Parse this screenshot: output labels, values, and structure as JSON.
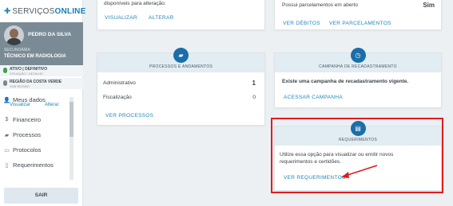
{
  "brand": {
    "prefix": "SERVIÇOS",
    "suffix": "ONLINE"
  },
  "profile": {
    "name": "PEDRO DA SILVA",
    "subtitle": "SECUNDÁRIA",
    "role": "TÉCNICO EM RADIOLOGIA"
  },
  "status": {
    "situacao": "ATIVO | DEFINITIVO",
    "situacao_detail": "SITUAÇÃO / DETALHE",
    "regiao": "REGIÃO DA COSTA VERDE",
    "regiao_detail": "SUB REGIÃO",
    "situacao_color": "#3fa14a",
    "regiao_color": "#7a8790"
  },
  "sidebar": {
    "meus_dados": "Meus dados",
    "visualizar": "Visualizar",
    "alterar": "Alterar",
    "items": [
      {
        "label": "Financeiro",
        "icon": "dollar-icon"
      },
      {
        "label": "Processos",
        "icon": "truck-icon"
      },
      {
        "label": "Protocolos",
        "icon": "folder-icon"
      },
      {
        "label": "Requerimentos",
        "icon": "document-icon"
      }
    ],
    "logout": "SAIR"
  },
  "top_left_card": {
    "text": "disponíveis para alteração.",
    "visualizar": "VISUALIZAR",
    "alterar": "ALTERAR"
  },
  "top_right_card": {
    "question": "Possui parcelamentos em aberto",
    "answer": "Sim",
    "ver_debitos": "VER DÉBITOS",
    "ver_parcelamentos": "VER PARCELAMENTOS"
  },
  "processos_card": {
    "title": "PROCESSOS E ANDAMENTOS",
    "rows": [
      {
        "label": "Administrativo",
        "value": "1"
      },
      {
        "label": "Fiscalização",
        "value": "0"
      }
    ],
    "link": "VER PROCESSOS"
  },
  "recadastramento_card": {
    "title": "CAMPANHA DE RECADASTRAMENTO",
    "text": "Existe uma campanha de recadastramento vigente.",
    "link": "ACESSAR CAMPANHA"
  },
  "requerimentos_card": {
    "title": "REQUERIMENTOS",
    "text_line1": "Utilize essa opção para visualizar ou emitir novos",
    "text_line2": "requerimentos e certidões.",
    "link": "VER REQUERIMENTOS"
  },
  "colors": {
    "accent": "#1f86b8",
    "icon_bg": "#1b6ea8",
    "highlight": "#e01c1c"
  }
}
